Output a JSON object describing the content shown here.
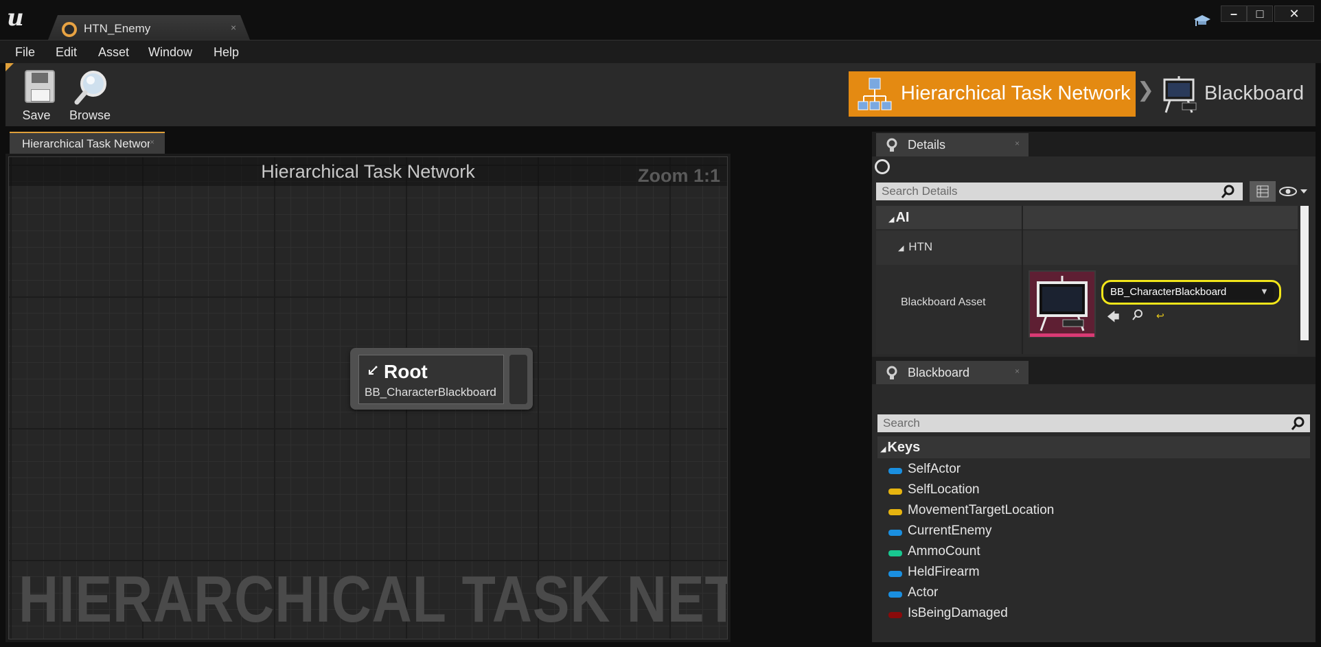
{
  "window": {
    "tab_title": "HTN_Enemy",
    "tab_close": "×",
    "minimize": "–",
    "maximize": "□",
    "close": "✕"
  },
  "menu": [
    "File",
    "Edit",
    "Asset",
    "Window",
    "Help"
  ],
  "toolbar": {
    "save_label": "Save",
    "browse_label": "Browse",
    "mode_htn_label": "Hierarchical Task Network",
    "mode_chevron": "❯",
    "mode_blackboard_label": "Blackboard",
    "accent_color": "#e48a12"
  },
  "graph": {
    "tab_label": "Hierarchical Task Network",
    "tab_close": "×",
    "title": "Hierarchical Task Network",
    "zoom": "Zoom 1:1",
    "watermark": "HIERARCHICAL TASK NETWORK",
    "root_node": {
      "title": "Root",
      "subtitle": "BB_CharacterBlackboard"
    }
  },
  "details": {
    "tab_label": "Details",
    "tab_close": "×",
    "search_placeholder": "Search Details",
    "category_ai": "AI",
    "category_htn": "HTN",
    "property_label": "Blackboard Asset",
    "asset_value": "BB_CharacterBlackboard",
    "highlight_color": "#f2e61a"
  },
  "blackboard": {
    "tab_label": "Blackboard",
    "tab_close": "×",
    "search_placeholder": "Search",
    "keys_header": "Keys",
    "keys": [
      {
        "name": "SelfActor",
        "color": "#1a8fe0"
      },
      {
        "name": "SelfLocation",
        "color": "#e6b410"
      },
      {
        "name": "MovementTargetLocation",
        "color": "#e6b410"
      },
      {
        "name": "CurrentEnemy",
        "color": "#1a8fe0"
      },
      {
        "name": "AmmoCount",
        "color": "#18c890"
      },
      {
        "name": "HeldFirearm",
        "color": "#1a8fe0"
      },
      {
        "name": "Actor",
        "color": "#1a8fe0"
      },
      {
        "name": "IsBeingDamaged",
        "color": "#8a0a0a"
      }
    ]
  }
}
